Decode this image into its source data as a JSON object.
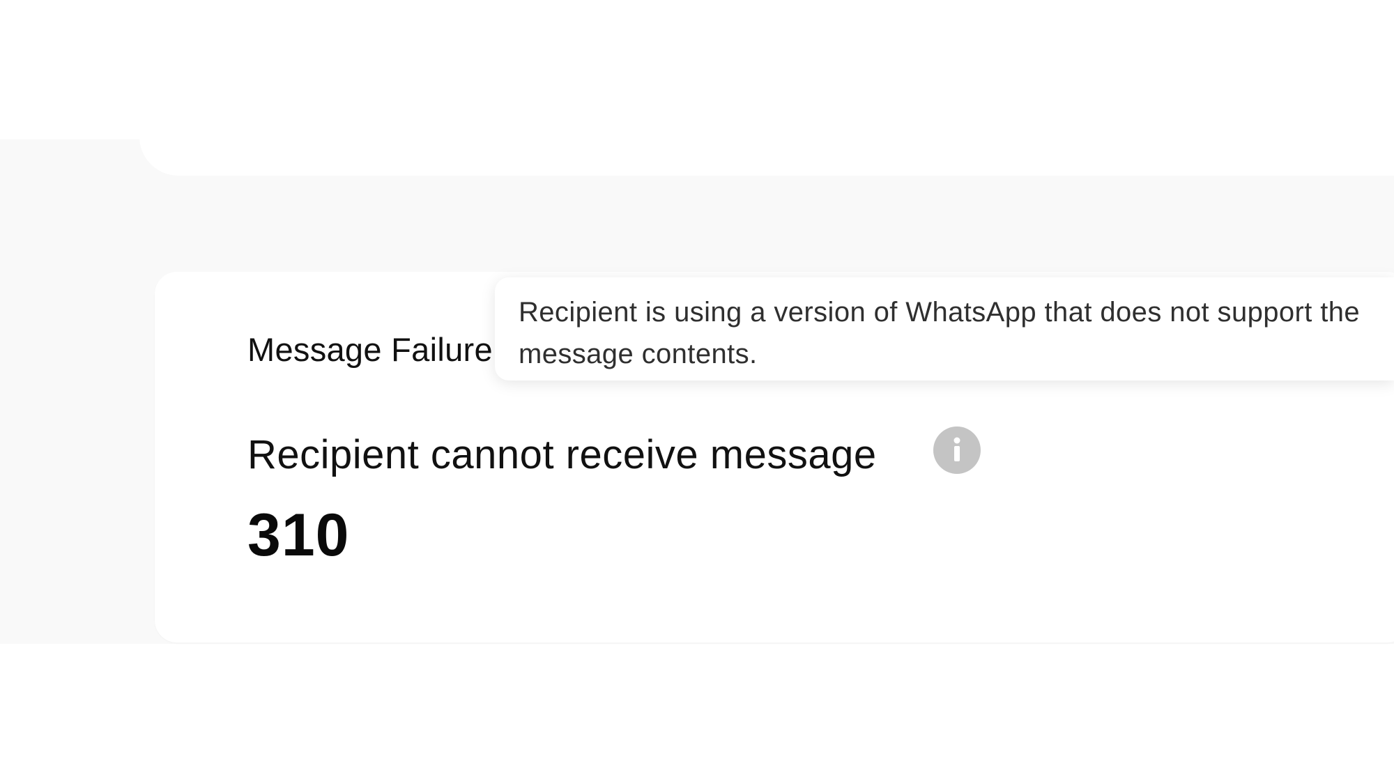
{
  "card": {
    "title": "Message Failure",
    "metric": {
      "label": "Recipient cannot receive message",
      "value": "310",
      "info_icon": "info-icon"
    }
  },
  "tooltip": {
    "line1": "Recipient is using a version of WhatsApp that does not support the",
    "line2": "message contents."
  },
  "colors": {
    "background": "#ffffff",
    "panel": "#f9f9f9",
    "icon": "#c4c4c4",
    "text": "#111111"
  }
}
